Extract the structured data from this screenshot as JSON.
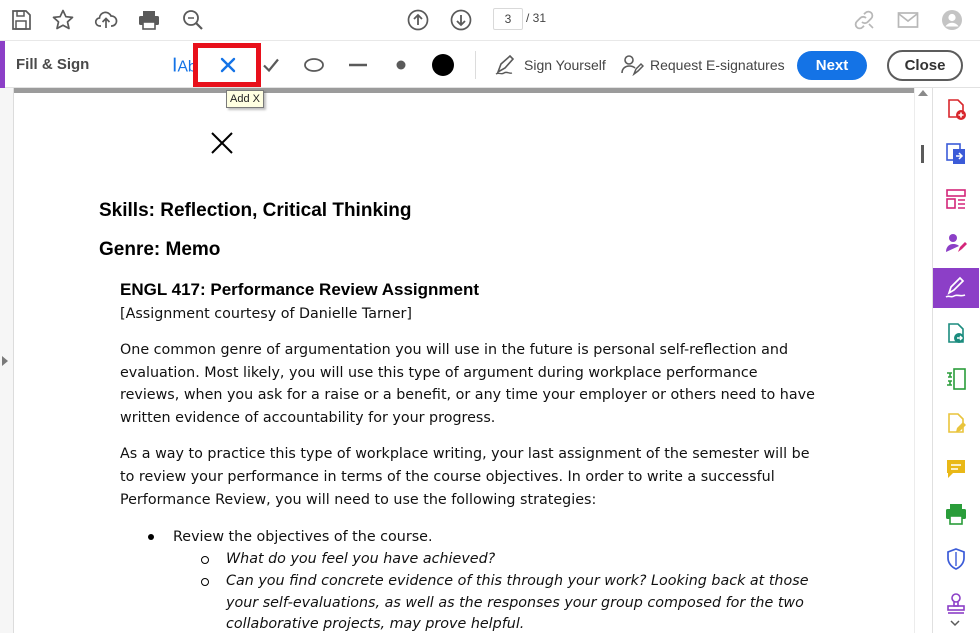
{
  "toolbar": {
    "current_page": "3",
    "total_pages": "/ 31",
    "icons": [
      "save-icon",
      "bookmark-star-icon",
      "cloud-upload-icon",
      "print-icon",
      "zoom-search-icon",
      "page-up-icon",
      "page-down-icon",
      "link-icon",
      "mail-icon",
      "account-icon"
    ]
  },
  "fill_sign": {
    "title": "Fill & Sign",
    "tools": [
      "text-tool",
      "add-x-tool",
      "checkmark-tool",
      "ellipse-tool",
      "line-tool",
      "dot-tool",
      "filled-dot-tool"
    ],
    "tooltip": "Add X",
    "sign_yourself": "Sign Yourself",
    "request_esignatures": "Request E-signatures",
    "next_label": "Next",
    "close_label": "Close",
    "accent_color": "#8c3fc7",
    "highlight_color": "#e8101b",
    "primary_color": "#1473e6"
  },
  "document": {
    "heading1": "Skills: Reflection, Critical Thinking",
    "heading2": "Genre: Memo",
    "heading3": "ENGL 417: Performance Review Assignment",
    "courtesy": "[Assignment courtesy of Danielle Tarner]",
    "para1": [
      "One common genre of argumentation you will use in the future is personal self-reflection and",
      "evaluation.  Most likely, you will use this type of argument during workplace performance",
      "reviews, when you ask for a raise or a benefit, or any time your employer or others need to have",
      "written evidence of accountability for your progress."
    ],
    "para2": [
      "As a way to practice this type of workplace writing, your last assignment of the semester will be",
      "to review your performance in terms of the course objectives.  In order to write a successful",
      "Performance Review, you will need to use the following strategies:"
    ],
    "bullet1": "Review the objectives of the course.",
    "sub1": "What do you feel you have achieved?",
    "sub2": [
      "Can you find concrete evidence of this through your work? Looking back at those",
      "your self-evaluations, as well as the responses your group composed for the two",
      "collaborative projects, may prove helpful."
    ]
  },
  "right_rail": {
    "tools": [
      "create-pdf-icon",
      "export-pdf-icon",
      "organize-pages-icon",
      "request-signatures-icon",
      "fill-sign-icon",
      "send-for-review-icon",
      "compress-pdf-icon",
      "edit-pdf-icon",
      "comment-icon",
      "print-production-icon",
      "protect-icon",
      "stamp-icon"
    ],
    "active_tool": "fill-sign-icon"
  }
}
